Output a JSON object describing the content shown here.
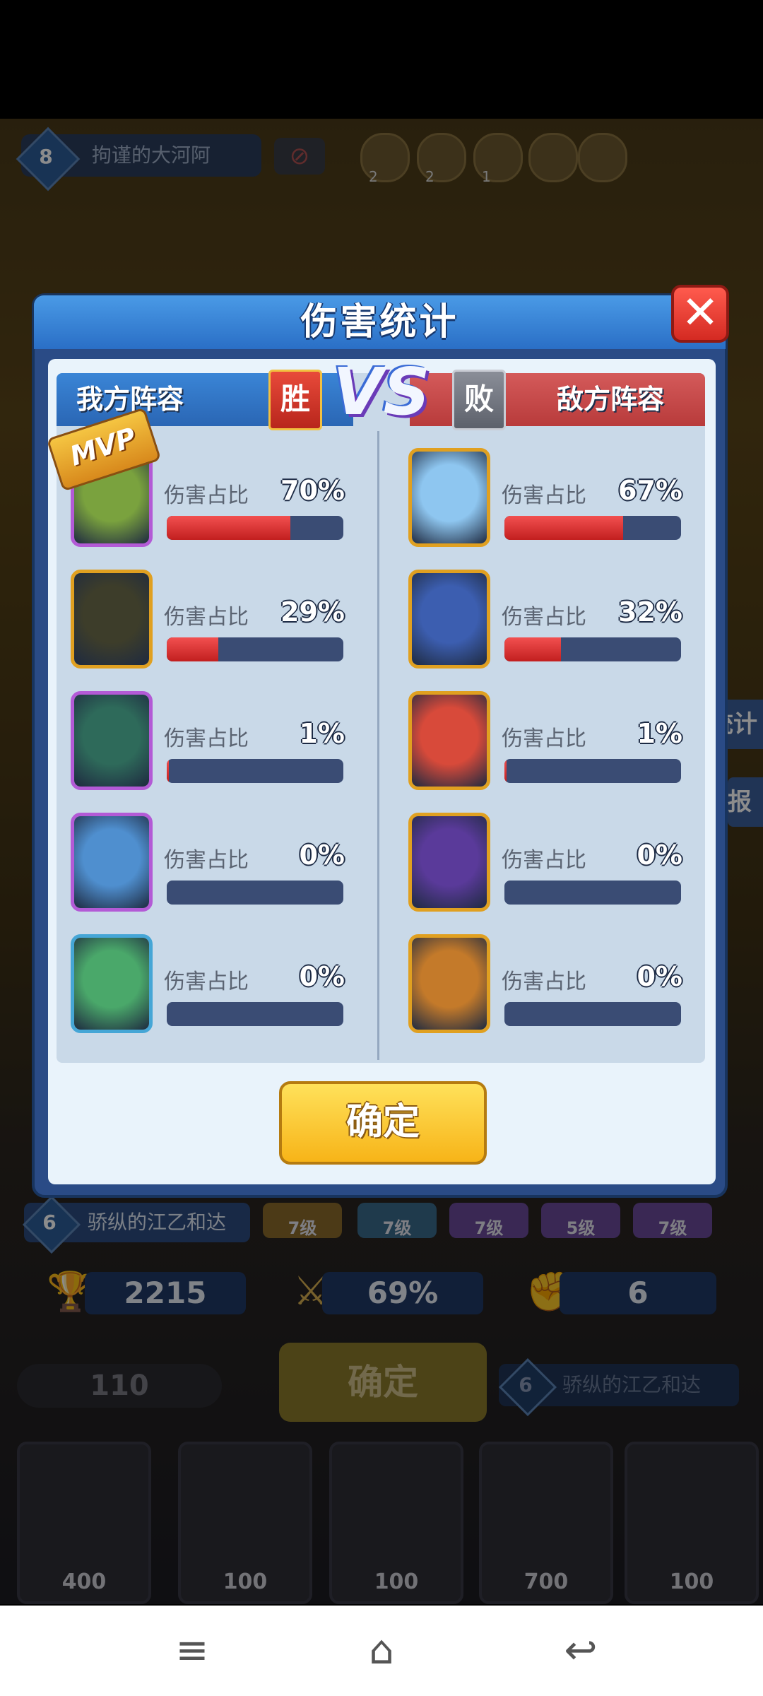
{
  "dialog": {
    "title": "伤害统计",
    "close_label": "✕",
    "our_team_label": "我方阵容",
    "enemy_team_label": "敌方阵容",
    "win_label": "胜",
    "lose_label": "败",
    "vs_label": "VS",
    "mvp_label": "MVP",
    "confirm_label": "确定",
    "damage_label": "伤害占比",
    "our_team": [
      {
        "pct_text": "70%",
        "pct": 70,
        "frame": "#b35ad6",
        "skin": "#7aa23e"
      },
      {
        "pct_text": "29%",
        "pct": 29,
        "frame": "#e0a020",
        "skin": "#3d3d2a"
      },
      {
        "pct_text": "1%",
        "pct": 1,
        "frame": "#b35ad6",
        "skin": "#2e6a5a"
      },
      {
        "pct_text": "0%",
        "pct": 0,
        "frame": "#b35ad6",
        "skin": "#4f8fcf"
      },
      {
        "pct_text": "0%",
        "pct": 0,
        "frame": "#45a6d6",
        "skin": "#4aa86a"
      }
    ],
    "enemy_team": [
      {
        "pct_text": "67%",
        "pct": 67,
        "frame": "#e0a020",
        "skin": "#8ec6f0"
      },
      {
        "pct_text": "32%",
        "pct": 32,
        "frame": "#e0a020",
        "skin": "#3c5eb0"
      },
      {
        "pct_text": "1%",
        "pct": 1,
        "frame": "#e0a020",
        "skin": "#d84a3a"
      },
      {
        "pct_text": "0%",
        "pct": 0,
        "frame": "#e0a020",
        "skin": "#5a3a9a"
      },
      {
        "pct_text": "0%",
        "pct": 0,
        "frame": "#e0a020",
        "skin": "#c47a2a"
      }
    ]
  },
  "background": {
    "top_player_level": "8",
    "top_player_name": "拘谨的大河阿",
    "top_icon_counts": [
      "2",
      "2",
      "1"
    ],
    "side_label_1": "统计",
    "side_label_2": "报",
    "bottom_player_level": "6",
    "bottom_player_name": "骄纵的江乙和达",
    "level_chips": [
      "7级",
      "7级",
      "7级",
      "5级",
      "7级"
    ],
    "trophies": "2215",
    "win_rate": "69%",
    "score": "6",
    "coins": "110",
    "confirm_label": "确定",
    "right_player_level": "6",
    "right_player_name": "骄纵的江乙和达",
    "card_costs": [
      "400",
      "100",
      "100",
      "700",
      "100"
    ]
  },
  "nav": {
    "menu_icon": "≡",
    "home_icon": "⌂",
    "back_icon": "↩"
  },
  "colors": {
    "damage_bar": "#e03030",
    "bar_track": "#3a4c74",
    "ours_header": "#2a66b4",
    "enemy_header": "#b83b3b",
    "confirm_button": "#f7b418"
  }
}
